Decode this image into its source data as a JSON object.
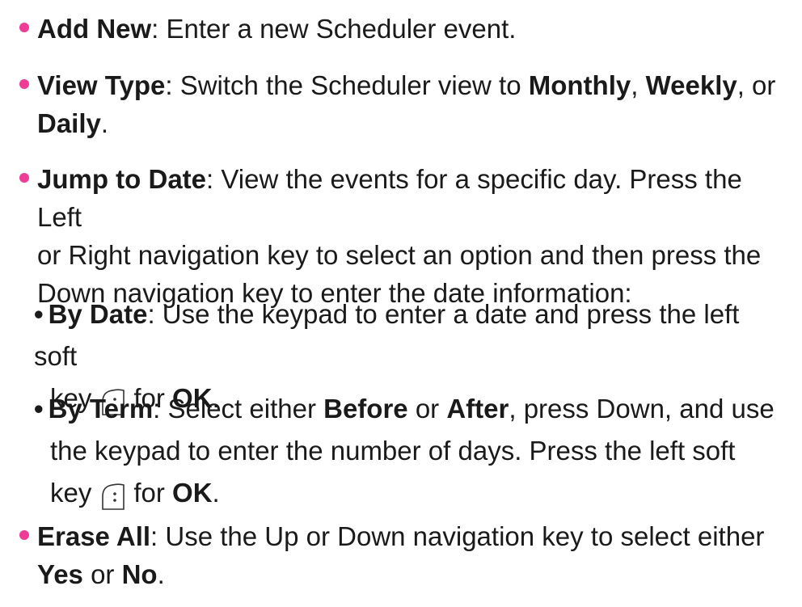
{
  "items": [
    {
      "term": "Add New",
      "desc": ": Enter a new Scheduler event."
    },
    {
      "term": "View Type",
      "desc_a": ": Switch the Scheduler view to ",
      "monthly": "Monthly",
      "comma1": ", ",
      "weekly": "Weekly",
      "comma2": ", or",
      "daily": "Daily",
      "end": "."
    },
    {
      "term": "Jump to Date",
      "desc_l1": ": View the events for a specific day. Press the Left",
      "desc_l2": "or Right navigation key to select an option and then press the",
      "desc_l3": "Down navigation key to enter the date information:"
    },
    {
      "term": "Erase All",
      "desc_l1": ": Use the Up or Down navigation key to select either",
      "yes": "Yes",
      "or": " or ",
      "no": "No",
      "end": "."
    }
  ],
  "subitems": [
    {
      "term": "By Date",
      "l1": ": Use the keypad to enter a date and press the left soft",
      "l2_a": "key",
      "l2_b": "for",
      "ok": "OK",
      "end": "."
    },
    {
      "term": "By Term",
      "l1_a": ": Select either ",
      "before": "Before",
      "l1_b": " or ",
      "after": "After",
      "l1_c": ", press Down, and use",
      "l2": "the keypad to enter the number of days. Press the left soft",
      "l3_a": "key",
      "l3_b": "for",
      "ok": "OK",
      "end": "."
    }
  ],
  "icons": {
    "soft_key": "left-soft-key-icon"
  },
  "colors": {
    "bullet": "#ee3d96"
  }
}
